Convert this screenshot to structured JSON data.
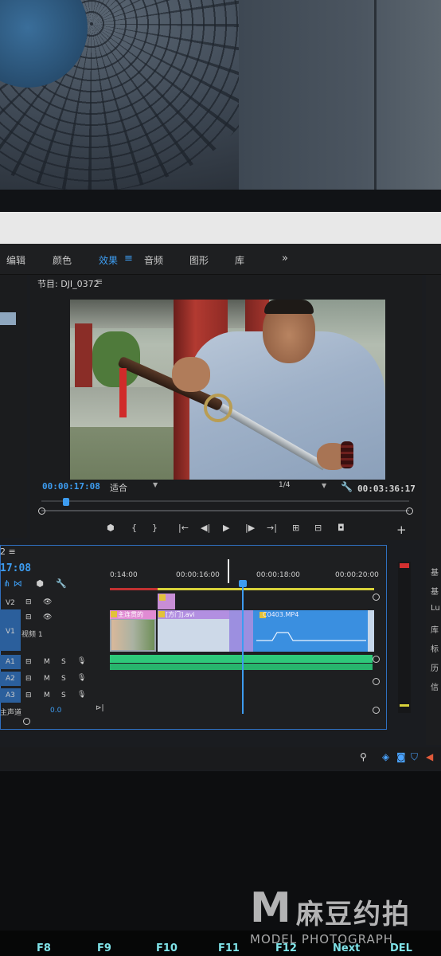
{
  "watermark": {
    "brand_mark": "M",
    "brand_zh": "麻豆约拍",
    "brand_en": "MODEL PHOTOGRAPH"
  },
  "keyboard": {
    "keys": [
      "F8",
      "F9",
      "F10",
      "F11",
      "F12",
      "Next",
      "DEL"
    ]
  },
  "workspaces": {
    "items": [
      {
        "label": "编辑",
        "active": false
      },
      {
        "label": "颜色",
        "active": false
      },
      {
        "label": "效果",
        "active": true
      },
      {
        "label": "音频",
        "active": false
      },
      {
        "label": "图形",
        "active": false
      },
      {
        "label": "库",
        "active": false
      }
    ],
    "menu_icon": "≡",
    "more_icon": "»"
  },
  "program_monitor": {
    "title": "节目: DJI_0372",
    "menu_icon": "≡",
    "current_timecode": "00:00:17:08",
    "fit_label": "适合",
    "quality_label": "1/4",
    "duration_timecode": "00:03:36:17",
    "controls": [
      "marker-icon",
      "mark-in-icon",
      "mark-out-icon",
      "go-to-in-icon",
      "step-back-icon",
      "play-icon",
      "step-forward-icon",
      "go-to-out-icon",
      "lift-icon",
      "extract-icon",
      "export-frame-icon"
    ],
    "add_button": "+"
  },
  "right_panel": {
    "items": [
      "基",
      "基",
      "Lu",
      "库",
      "标",
      "历",
      "信"
    ]
  },
  "timeline": {
    "tab_label": "2",
    "tab_menu": "≡",
    "timecode": "17:08",
    "ruler_ticks": [
      "0:14:00",
      "00:00:16:00",
      "00:00:18:00",
      "00:00:20:00"
    ],
    "tracks": {
      "v2": {
        "label": "V2"
      },
      "v1": {
        "label": "V1",
        "name": "视频 1"
      },
      "a1": {
        "label": "A1",
        "m": "M",
        "s": "S"
      },
      "a2": {
        "label": "A2",
        "m": "M",
        "s": "S"
      },
      "a3": {
        "label": "A3",
        "m": "M",
        "s": "S"
      },
      "master": {
        "label": "主声道",
        "value": "0.0"
      }
    },
    "clips": {
      "clip1": "主连贯的",
      "clip2": "[方门].avi",
      "clip4": "C0403.MP4"
    }
  },
  "colors": {
    "accent": "#3d9cf0",
    "timeline_border": "#2f6fbf",
    "audio_clip": "#2ec97a",
    "video_clip": "#3a8fe0"
  }
}
